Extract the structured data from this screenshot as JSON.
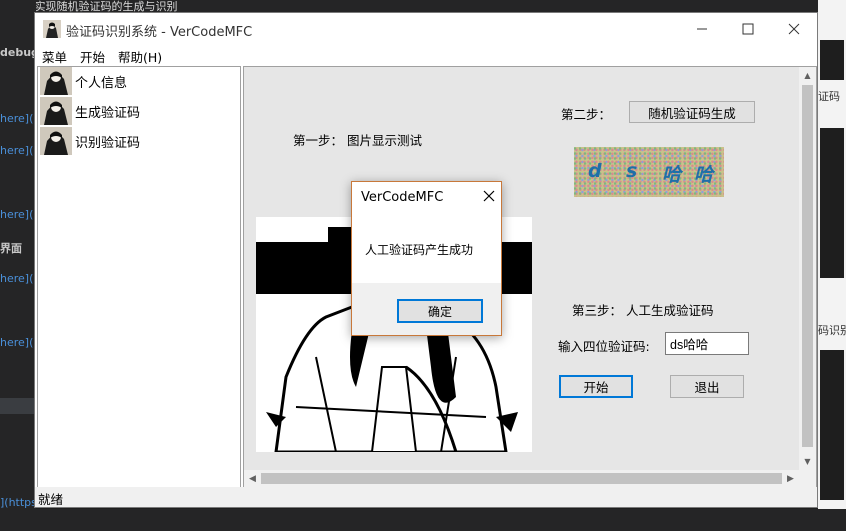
{
  "window": {
    "title": "验证码识别系统 - VerCodeMFC",
    "minimize_icon": "minimize-icon",
    "maximize_icon": "maximize-icon",
    "close_icon": "close-icon"
  },
  "menu": {
    "items": [
      "菜单",
      "开始",
      "帮助(H)"
    ]
  },
  "tree": {
    "items": [
      {
        "label": "个人信息"
      },
      {
        "label": "生成验证码"
      },
      {
        "label": "识别验证码"
      }
    ]
  },
  "main": {
    "step1_label": "第一步：  图片显示测试",
    "step2_label": "第二步：",
    "random_button": "随机验证码生成",
    "captcha_chars": [
      "d",
      "s",
      "哈",
      "哈"
    ],
    "step3_label": "第三步：  人工生成验证码",
    "input_label": "输入四位验证码:",
    "input_value": "ds哈哈",
    "start_button": "开始",
    "exit_button": "退出"
  },
  "status": {
    "text": "就绪"
  },
  "dialog": {
    "title": "VerCodeMFC",
    "message": "人工验证码产生成功",
    "ok_button": "确定"
  },
  "background": {
    "top_text": "用MFC实现随机验证码的生成与识别",
    "left_lines": [
      "debug",
      "here](",
      "here](",
      "here](",
      "界面",
      "here](",
      "here](",
      "](https"
    ],
    "right_lines": [
      "证码",
      "码识别"
    ]
  },
  "colors": {
    "accent": "#0078d7",
    "captcha_text": "#1f6fa8",
    "dialog_border": "#c8783a"
  }
}
